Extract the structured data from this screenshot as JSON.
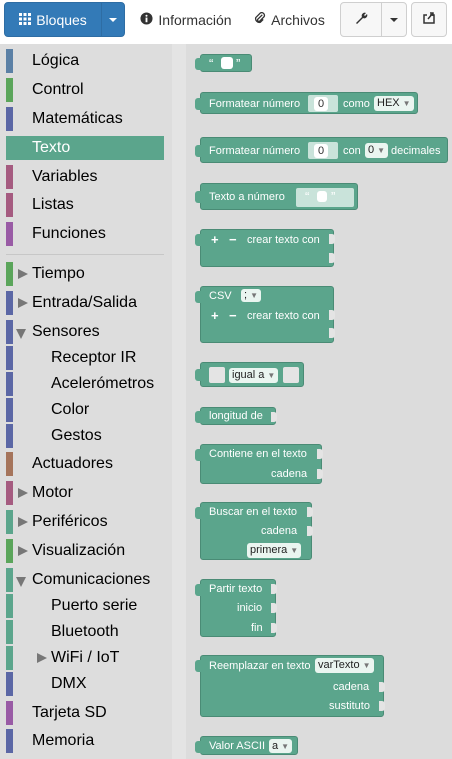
{
  "toolbar": {
    "bloques": "Bloques",
    "informacion": "Información",
    "archivos": "Archivos"
  },
  "sidebar": {
    "categories": [
      {
        "label": "Lógica",
        "color": "#5b80a5"
      },
      {
        "label": "Control",
        "color": "#5ba55b"
      },
      {
        "label": "Matemáticas",
        "color": "#5b67a5"
      },
      {
        "label": "Texto",
        "color": "#5ba58c",
        "selected": true
      },
      {
        "label": "Variables",
        "color": "#a55b80"
      },
      {
        "label": "Listas",
        "color": "#a5745b"
      },
      {
        "label": "Funciones",
        "color": "#995ba5"
      },
      {
        "label": "Tiempo",
        "color": "#5ba55b"
      },
      {
        "label": "Entrada/Salida",
        "color": "#5b67a5"
      },
      {
        "label": "Sensores",
        "color": "#5b67a5"
      },
      {
        "label": "Receptor IR",
        "color": "#5b67a5"
      },
      {
        "label": "Acelerómetros",
        "color": "#5b67a5"
      },
      {
        "label": "Color",
        "color": "#5b67a5"
      },
      {
        "label": "Gestos",
        "color": "#5b67a5"
      },
      {
        "label": "Actuadores",
        "color": "#a5745b"
      },
      {
        "label": "Motor",
        "color": "#a55b80"
      },
      {
        "label": "Periféricos",
        "color": "#5ba58c"
      },
      {
        "label": "Visualización",
        "color": "#5ba55b"
      },
      {
        "label": "Comunicaciones",
        "color": "#5ba58c"
      },
      {
        "label": "Puerto serie",
        "color": "#5ba58c"
      },
      {
        "label": "Bluetooth",
        "color": "#5ba58c"
      },
      {
        "label": "WiFi / IoT",
        "color": "#5ba58c"
      },
      {
        "label": "DMX",
        "color": "#5b67a5"
      },
      {
        "label": "Tarjeta SD",
        "color": "#995ba5"
      },
      {
        "label": "Memoria",
        "color": "#5b67a5"
      }
    ]
  },
  "blocks": {
    "quote_open": "“",
    "quote_close": "”",
    "formatear1": "Formatear número",
    "formatear1_num": "0",
    "como": "como",
    "hex": "HEX",
    "formatear2": "Formatear número",
    "formatear2_num": "0",
    "con": "con",
    "con_num": "0",
    "decimales": "decimales",
    "texto_a_numero": "Texto a número",
    "plus": "+",
    "minus": "−",
    "crear_texto_con": "crear texto con",
    "csv": "CSV",
    "csv_sep": ";",
    "crear_texto_con2": "crear texto con",
    "igual_a": "igual a",
    "longitud_de": "longitud de",
    "contiene": "Contiene en el texto",
    "cadena1": "cadena",
    "buscar": "Buscar en el texto",
    "cadena2": "cadena",
    "primera": "primera",
    "partir": "Partir texto",
    "inicio": "inicio",
    "fin": "fin",
    "reemplazar": "Reemplazar en texto",
    "vartexto": "varTexto",
    "cadena3": "cadena",
    "sustituto": "sustituto",
    "valor_ascii": "Valor ASCII",
    "ascii_char": "a"
  }
}
